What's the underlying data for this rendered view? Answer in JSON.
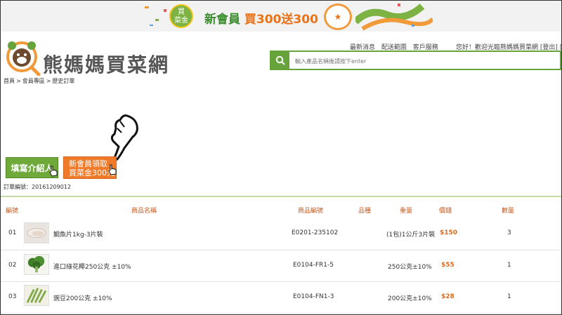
{
  "banner": {
    "coin_line1": "買",
    "coin_line2": "菜金",
    "text_prefix": "新會員",
    "text_highlight": "買300送300"
  },
  "header": {
    "brand_name": "熊媽媽買菜網",
    "top_links": [
      "最新消息",
      "配送範圍",
      "客戶服務"
    ],
    "user_links": "您好！歡迎光臨熊媽媽買菜網 [登出] [會員專區]",
    "search_placeholder": "輸入產品名稱後請按下enter"
  },
  "breadcrumb": [
    "首頁",
    ">",
    "會員專區",
    ">",
    "歷史訂單"
  ],
  "actions": {
    "referral_label": "填寫介紹人",
    "coupon_line1": "新會員領取",
    "coupon_line2": "買菜金300元"
  },
  "order": {
    "label": "訂單編號：20161209012"
  },
  "table": {
    "headers": [
      "編號",
      "商品名稱",
      "商品編號",
      "品種",
      "重量",
      "價錢",
      "數量"
    ],
    "rows": [
      {
        "no": "01",
        "name": "鯛魚片1kg-3片裝",
        "code": "E0201-235102",
        "variety": "",
        "weight": "(1包)1公斤3片裝",
        "price": "$150",
        "qty": "3"
      },
      {
        "no": "02",
        "name": "進口綠花椰250公克 ±10%",
        "code": "E0104-FR1-5",
        "variety": "",
        "weight": "250公克±10%",
        "price": "$55",
        "qty": "1"
      },
      {
        "no": "03",
        "name": "豌豆200公克 ±10%",
        "code": "E0104-FN1-3",
        "variety": "",
        "weight": "200公克±10%",
        "price": "$28",
        "qty": "1"
      }
    ]
  },
  "colors": {
    "brand_green": "#66a33a",
    "accent_orange": "#ef7b2a",
    "header_text": "#c45a1f"
  }
}
